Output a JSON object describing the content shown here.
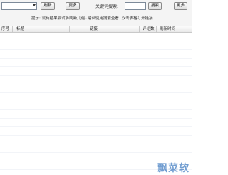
{
  "toolbar": {
    "url_value": "",
    "refresh_label": "刷新",
    "more_label": "更多",
    "keyword_label": "关键词搜索:",
    "keyword_value": "",
    "search_label": "搜索",
    "more2_label": "更多",
    "tip_prefix": "提示:",
    "tip_part1": "没有结果尝试多刷新几遍",
    "tip_sep": "·",
    "tip_part2": "建议使用搜索查看",
    "tip_part3": "双击表格打开链接"
  },
  "table": {
    "columns": [
      "序号",
      "标题",
      "链接",
      "评论数",
      "刷新时间"
    ],
    "rows": []
  },
  "watermark": "飘菜软"
}
